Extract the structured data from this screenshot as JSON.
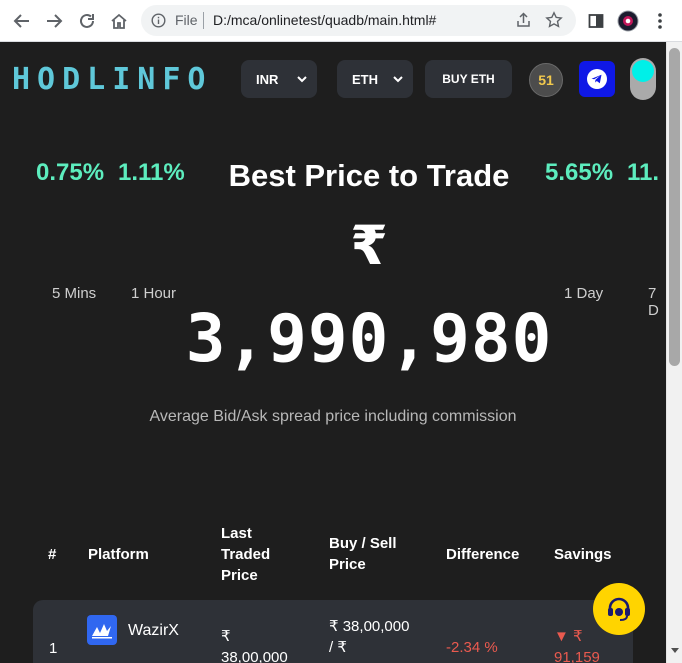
{
  "browser": {
    "file_label": "File",
    "url": "D:/mca/onlinetest/quadb/main.html#"
  },
  "header": {
    "logo": "HODLINFO",
    "currency_select": "INR",
    "coin_select": "ETH",
    "buy_button": "BUY ETH",
    "timer": "51"
  },
  "hero": {
    "title": "Best Price to Trade",
    "currency_symbol": "₹",
    "price": "3,990,980",
    "caption": "Average Bid/Ask spread price including commission",
    "changes": [
      {
        "value": "0.75%",
        "period": "5 Mins"
      },
      {
        "value": "1.11%",
        "period": "1 Hour"
      },
      {
        "value": "5.65%",
        "period": "1 Day"
      },
      {
        "value": "11.",
        "period": "7 D"
      }
    ]
  },
  "table": {
    "headers": {
      "index": "#",
      "platform": "Platform",
      "last_traded_1": "Last",
      "last_traded_2": "Traded",
      "last_traded_3": "Price",
      "buy_sell_1": "Buy / Sell",
      "buy_sell_2": "Price",
      "difference": "Difference",
      "savings": "Savings"
    },
    "rows": [
      {
        "index": "1",
        "platform": "WazirX",
        "last_traded_1": "₹",
        "last_traded_2": "38,00,000",
        "buy_sell_1": "₹ 38,00,000",
        "buy_sell_2": "/ ₹",
        "difference": "-2.34 %",
        "savings_1": "▼ ₹",
        "savings_2": "91,159"
      }
    ]
  },
  "colors": {
    "background": "#1e1e1e",
    "logo": "#5fc8d9",
    "positive": "#5dedbe",
    "negative": "#ea5a4f",
    "telegram": "#0f18e6",
    "support": "#ffd400"
  },
  "icons": [
    "back-arrow-icon",
    "forward-arrow-icon",
    "reload-icon",
    "home-icon",
    "info-icon",
    "share-icon",
    "star-icon",
    "sidebar-icon",
    "profile-icon",
    "kebab-menu-icon",
    "chevron-down-icon",
    "telegram-icon",
    "headset-icon"
  ]
}
